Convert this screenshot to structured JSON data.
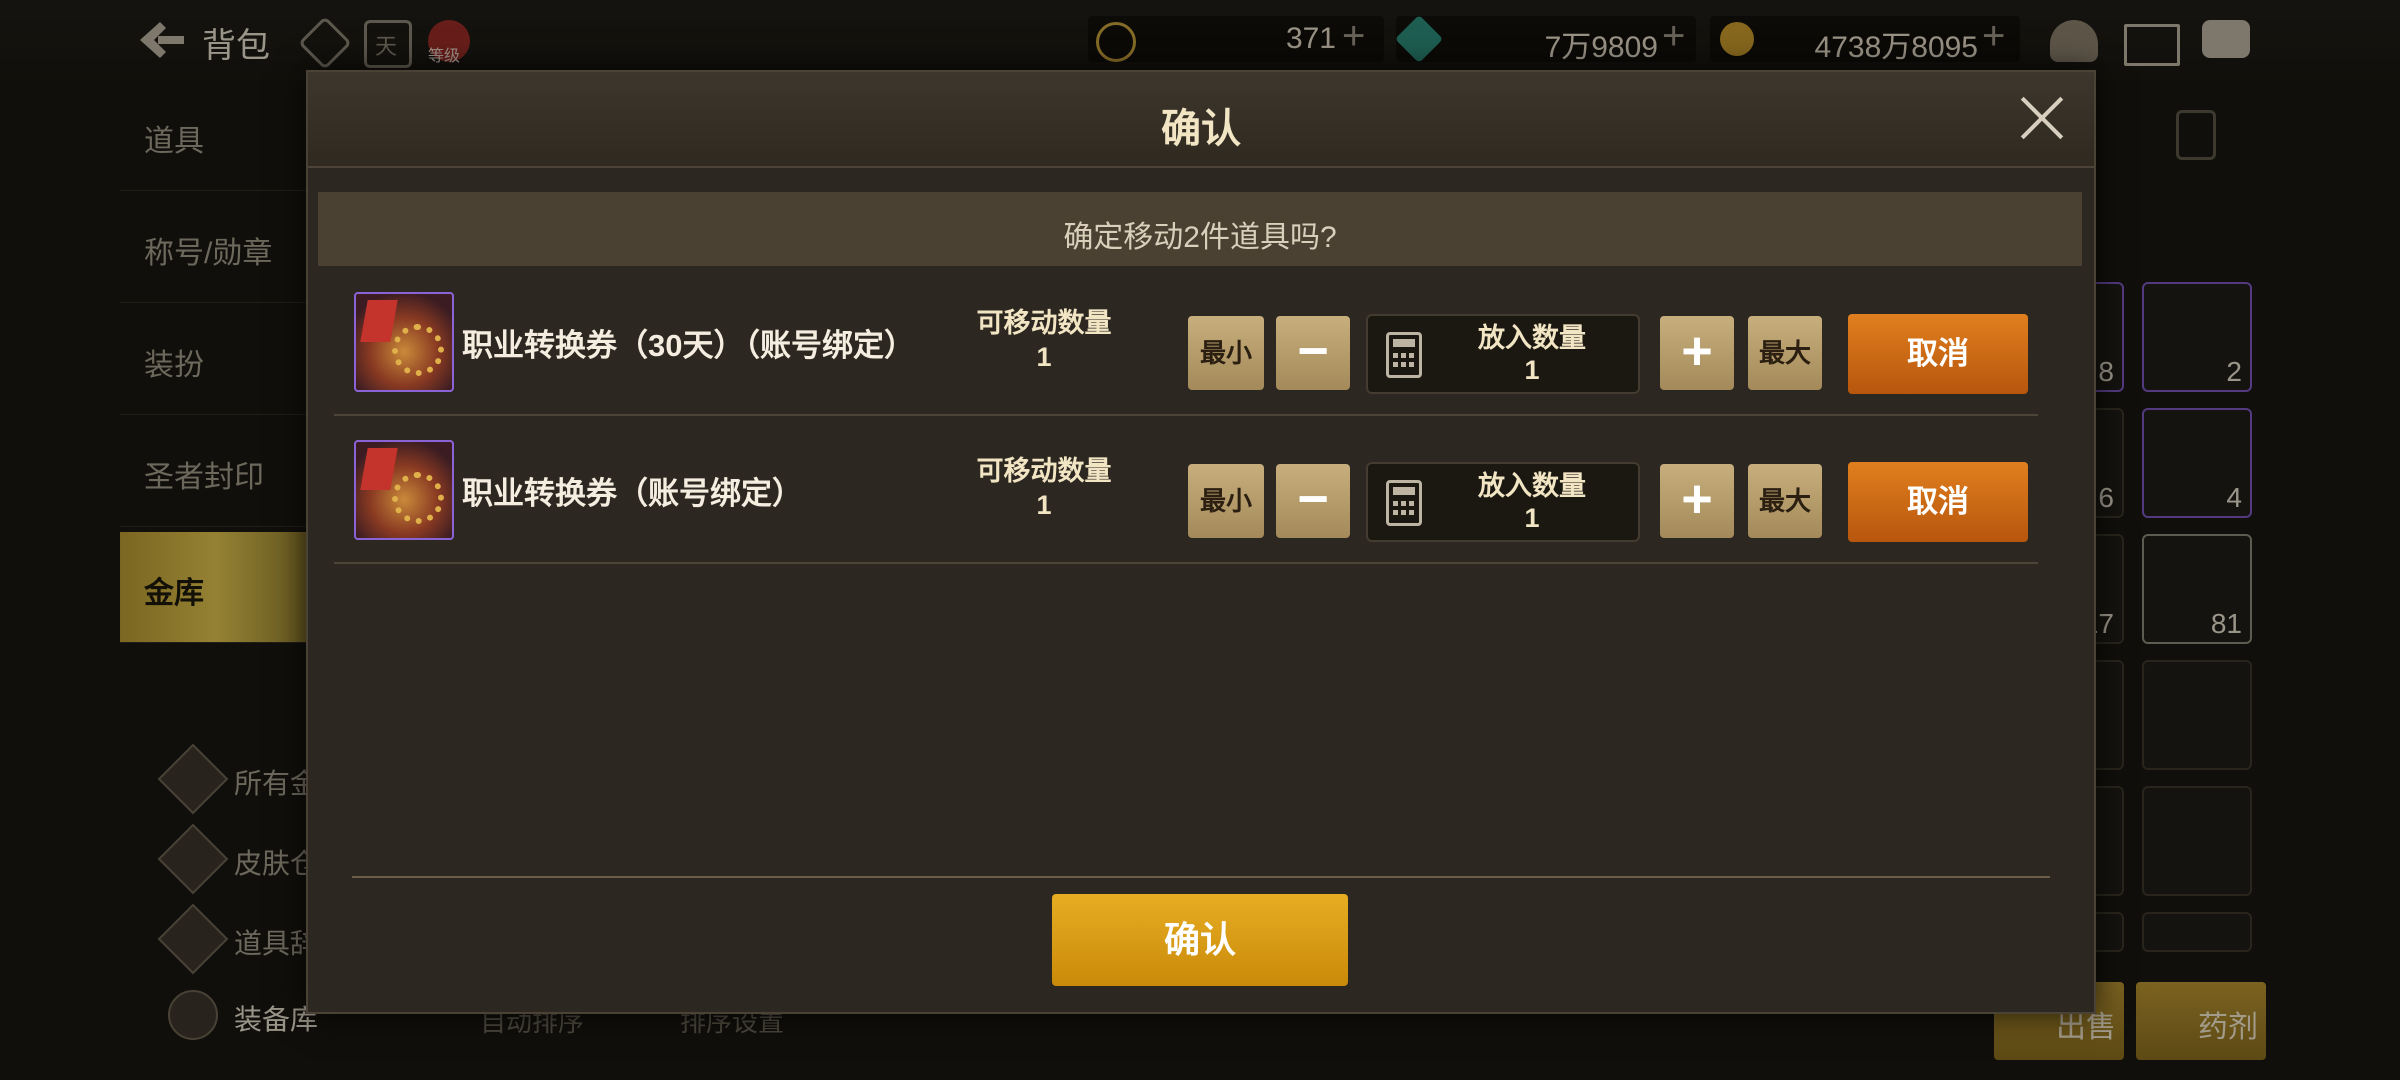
{
  "topbar": {
    "title": "背包",
    "res1_value": "371",
    "res2_value": "7万9809",
    "res3_value": "4738万8095",
    "plus": "+",
    "day_icon": "天",
    "level_icon": "等级"
  },
  "sidebar": {
    "items": [
      {
        "label": "道具"
      },
      {
        "label": "称号/勋章"
      },
      {
        "label": "装扮"
      },
      {
        "label": "圣者封印"
      },
      {
        "label": "金库"
      }
    ],
    "sub_items": [
      {
        "label": "所有金库"
      },
      {
        "label": "皮肤仓库"
      },
      {
        "label": "道具辞典"
      },
      {
        "label": "装备库"
      }
    ]
  },
  "background": {
    "auto_sort": "自动排序",
    "sort_settings": "排序设置",
    "slot_counts": [
      "8",
      "2",
      "6",
      "4",
      "17",
      "81"
    ],
    "sell_label": "出售",
    "potion_label": "药剂"
  },
  "modal": {
    "title": "确认",
    "question": "确定移动2件道具吗?",
    "items": [
      {
        "name": "职业转换券（30天）（账号绑定）",
        "movable_label": "可移动数量",
        "movable_value": "1",
        "min_label": "最小",
        "minus": "−",
        "qty_label": "放入数量",
        "qty_value": "1",
        "plus": "+",
        "max_label": "最大",
        "cancel_label": "取消"
      },
      {
        "name": "职业转换券（账号绑定）",
        "movable_label": "可移动数量",
        "movable_value": "1",
        "min_label": "最小",
        "minus": "−",
        "qty_label": "放入数量",
        "qty_value": "1",
        "plus": "+",
        "max_label": "最大",
        "cancel_label": "取消"
      }
    ],
    "confirm_label": "确认"
  },
  "colors": {
    "accent_gold": "#e8ad23",
    "cancel_orange": "#e07f1e",
    "item_border_purple": "#8a63d6"
  }
}
